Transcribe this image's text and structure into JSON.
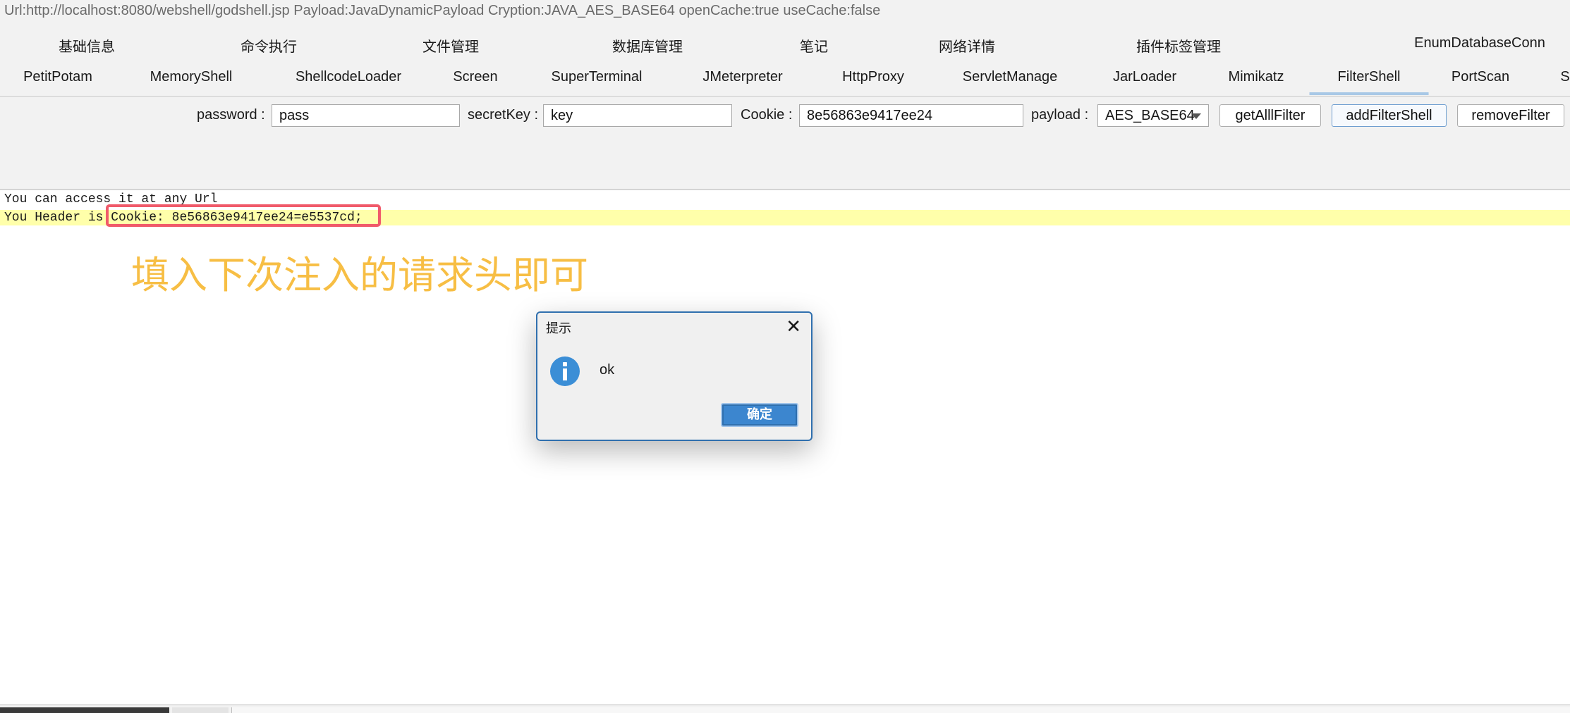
{
  "url_info": "Url:http://localhost:8080/webshell/godshell.jsp Payload:JavaDynamicPayload Cryption:JAVA_AES_BASE64 openCache:true useCache:false",
  "tabs_row1": [
    "基础信息",
    "命令执行",
    "文件管理",
    "数据库管理",
    "笔记",
    "网络详情",
    "插件标签管理",
    "EnumDatabaseConn"
  ],
  "tabs_row2": [
    "PetitPotam",
    "MemoryShell",
    "ShellcodeLoader",
    "Screen",
    "SuperTerminal",
    "JMeterpreter",
    "HttpProxy",
    "ServletManage",
    "JarLoader",
    "Mimikatz",
    "FilterShell",
    "PortScan",
    "S"
  ],
  "active_tab": "FilterShell",
  "form": {
    "password_label": "password :",
    "password_value": "pass",
    "secretkey_label": "secretKey :",
    "secretkey_value": "key",
    "cookie_label": "Cookie :",
    "cookie_value": "8e56863e9417ee24",
    "payload_label": "payload :",
    "payload_value": "AES_BASE64",
    "btn_getall": "getAlllFilter",
    "btn_add": "addFilterShell",
    "btn_remove": "removeFilter"
  },
  "output": {
    "line1": "You can access it at any Url",
    "line2_prefix": "You Header is ",
    "line2_value": "Cookie: 8e56863e9417ee24=e5537cd;"
  },
  "annotation": "填入下次注入的请求头即可",
  "dialog": {
    "title": "提示",
    "message": "ok",
    "ok_label": "确定",
    "icon": "info-icon",
    "close_icon": "close-icon"
  },
  "colors": {
    "annotation": "#f7be44",
    "highlight_box": "#f05a6a",
    "highlight_line": "#ffffaa",
    "dialog_border": "#2f6fae",
    "ok_button": "#3c86cf"
  }
}
